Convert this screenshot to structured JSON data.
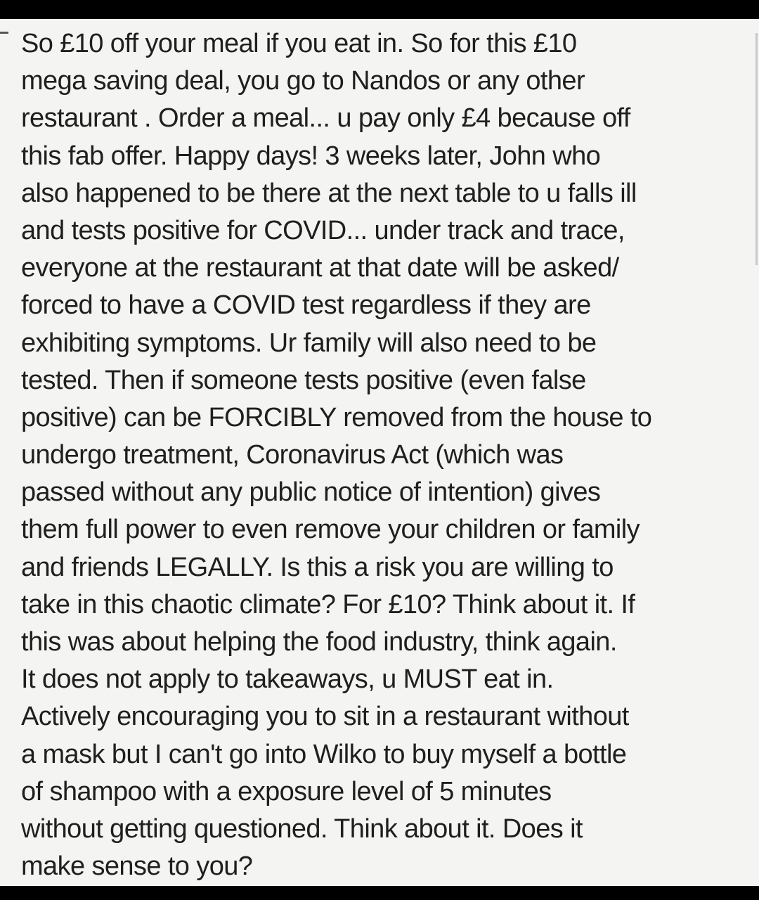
{
  "post": {
    "lines": [
      "So £10 off your meal if you eat in.  So for this £10",
      "mega saving deal, you go to Nandos or any other",
      "restaurant .  Order a meal... u pay only £4 because off",
      "this fab offer.  Happy days!  3 weeks later, John who",
      "also happened to be there at the next table to u falls ill",
      "and tests positive for COVID... under track and trace,",
      "everyone at the restaurant at that date will be asked/",
      "forced to have a COVID test regardless if they are",
      "exhibiting symptoms.  Ur family will also need to be",
      "tested.  Then if someone tests positive (even false",
      "positive) can be FORCIBLY removed from the house to",
      "undergo treatment, Coronavirus Act (which was",
      "passed without any public notice of intention) gives",
      "them full power to even remove your children or family",
      "and friends LEGALLY.  Is this a risk you are willing to",
      "take in this chaotic climate? For £10? Think about it.  If",
      "this was about helping the food industry, think again.",
      "It does not apply to takeaways, u MUST eat in.",
      "Actively encouraging you to sit in a restaurant without",
      "a mask but I can't go into Wilko to buy myself a bottle",
      "of shampoo with a exposure level of 5 minutes",
      "without getting questioned.  Think about it. Does it",
      "make sense to you?"
    ]
  },
  "colors": {
    "background": "#000000",
    "card": "#f4f4f2",
    "text": "#1f1f1f"
  }
}
